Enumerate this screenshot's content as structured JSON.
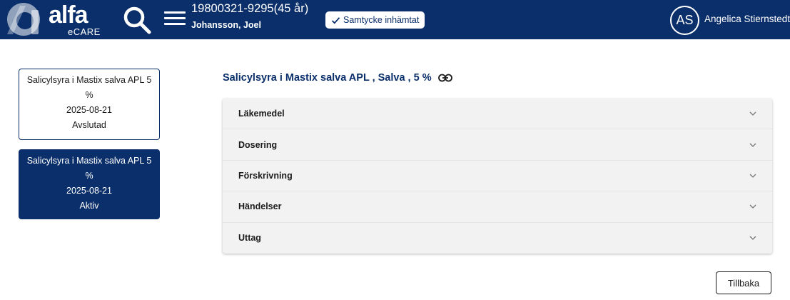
{
  "header": {
    "logo_text": "alfa",
    "logo_subtext": "eCARE",
    "patient_id": "19800321-9295(45 år)",
    "patient_name": "Johansson, Joel",
    "consent_label": "Samtycke inhämtat",
    "user_initials": "AS",
    "user_name": "Angelica Stiernstedt",
    "icons": [
      "alfa-logo-icon",
      "search-icon",
      "menu-icon",
      "check-icon"
    ],
    "colors": {
      "brand": "#0b2f6b",
      "text_on_brand": "#ffffff"
    }
  },
  "sidebar": {
    "items": [
      {
        "name_line1": "Salicylsyra i Mastix salva APL 5",
        "name_line2": "%",
        "date": "2025-08-21",
        "status": "Avslutad",
        "selected": false
      },
      {
        "name_line1": "Salicylsyra i Mastix salva APL 5",
        "name_line2": "%",
        "date": "2025-08-21",
        "status": "Aktiv",
        "selected": true
      }
    ]
  },
  "main": {
    "title": "Salicylsyra i Mastix salva APL , Salva , 5 %",
    "title_icon": "link-icon",
    "sections": [
      {
        "label": "Läkemedel",
        "icon": "chevron-down-icon"
      },
      {
        "label": "Dosering",
        "icon": "chevron-down-icon"
      },
      {
        "label": "Förskrivning",
        "icon": "chevron-down-icon"
      },
      {
        "label": "Händelser",
        "icon": "chevron-down-icon"
      },
      {
        "label": "Uttag",
        "icon": "chevron-down-icon"
      }
    ],
    "back_label": "Tillbaka"
  }
}
